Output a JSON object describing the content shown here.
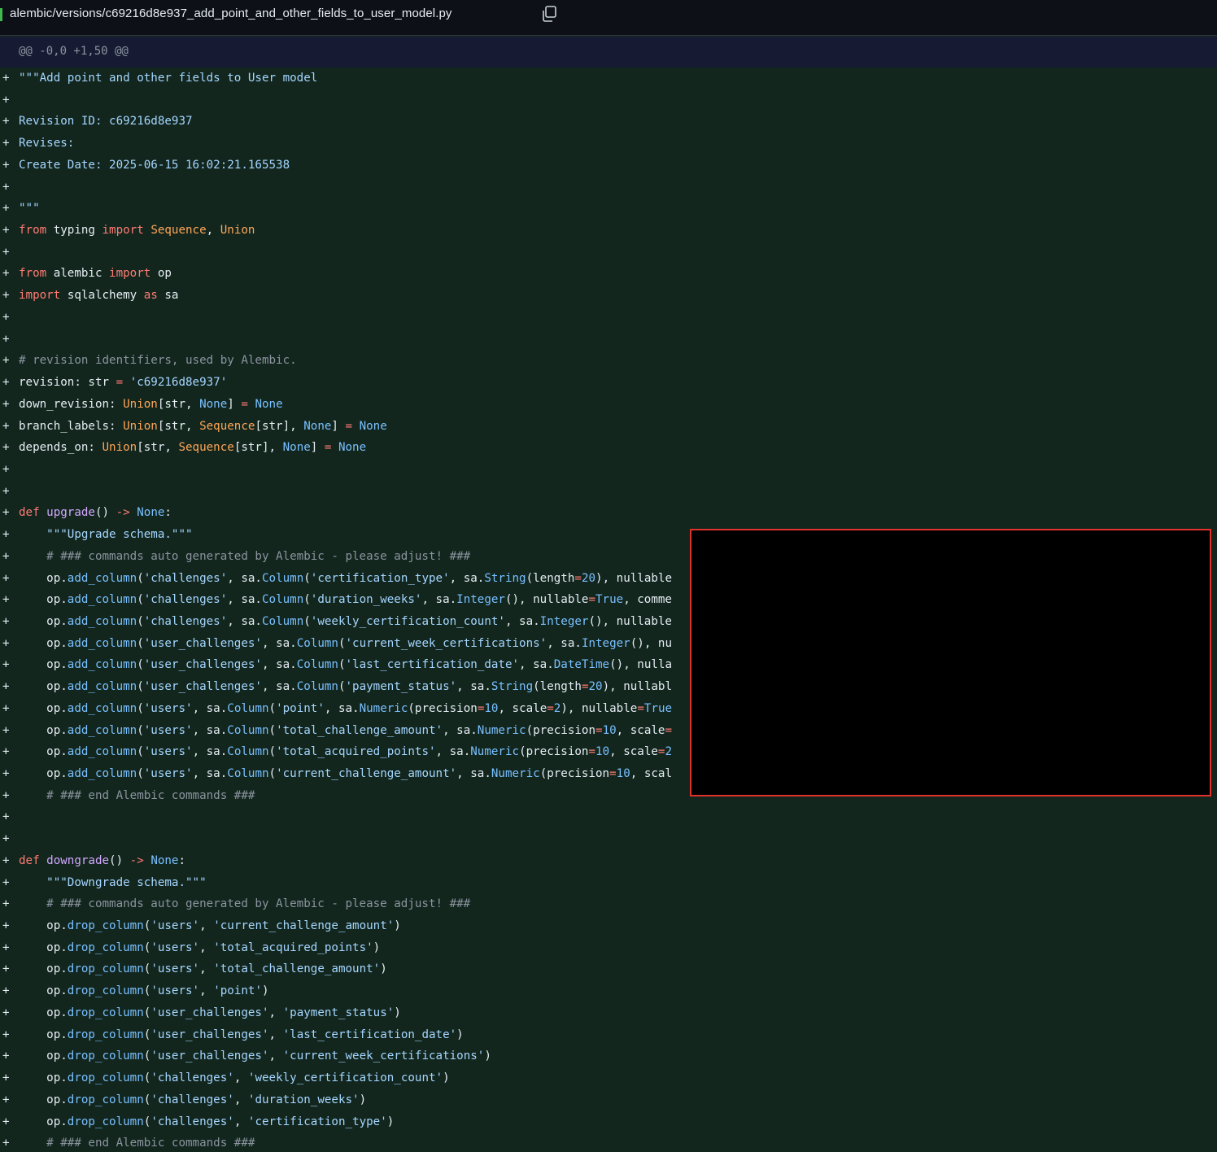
{
  "file": {
    "path": "alembic/versions/c69216d8e937_add_point_and_other_fields_to_user_model.py",
    "copy_icon": "copy-icon"
  },
  "hunk": {
    "header": "@@ -0,0 +1,50 @@"
  },
  "diff_marker": "+",
  "colors": {
    "added_bg": "#12261e",
    "keyword": "#ff7b72",
    "string": "#a5d6ff",
    "comment": "#8b949e",
    "function": "#d2a8ff",
    "class": "#ffa657",
    "constant": "#79c0ff"
  },
  "lines": [
    [
      [
        "s",
        "\"\"\"Add point and other fields to User model"
      ]
    ],
    [],
    [
      [
        "s",
        "Revision ID: c69216d8e937"
      ]
    ],
    [
      [
        "s",
        "Revises:"
      ]
    ],
    [
      [
        "s",
        "Create Date: 2025-06-15 16:02:21.165538"
      ]
    ],
    [],
    [
      [
        "s",
        "\"\"\""
      ]
    ],
    [
      [
        "k",
        "from"
      ],
      [
        "p",
        " typing "
      ],
      [
        "k",
        "import"
      ],
      [
        "p",
        " "
      ],
      [
        "y",
        "Sequence"
      ],
      [
        "p",
        ", "
      ],
      [
        "y",
        "Union"
      ]
    ],
    [],
    [
      [
        "k",
        "from"
      ],
      [
        "p",
        " alembic "
      ],
      [
        "k",
        "import"
      ],
      [
        "p",
        " op"
      ]
    ],
    [
      [
        "k",
        "import"
      ],
      [
        "p",
        " sqlalchemy "
      ],
      [
        "k",
        "as"
      ],
      [
        "p",
        " sa"
      ]
    ],
    [],
    [],
    [
      [
        "c",
        "# revision identifiers, used by Alembic."
      ]
    ],
    [
      [
        "p",
        "revision: str "
      ],
      [
        "k",
        "="
      ],
      [
        "p",
        " "
      ],
      [
        "s",
        "'c69216d8e937'"
      ]
    ],
    [
      [
        "p",
        "down_revision: "
      ],
      [
        "y",
        "Union"
      ],
      [
        "p",
        "[str, "
      ],
      [
        "n",
        "None"
      ],
      [
        "p",
        "] "
      ],
      [
        "k",
        "="
      ],
      [
        "p",
        " "
      ],
      [
        "n",
        "None"
      ]
    ],
    [
      [
        "p",
        "branch_labels: "
      ],
      [
        "y",
        "Union"
      ],
      [
        "p",
        "[str, "
      ],
      [
        "y",
        "Sequence"
      ],
      [
        "p",
        "[str], "
      ],
      [
        "n",
        "None"
      ],
      [
        "p",
        "] "
      ],
      [
        "k",
        "="
      ],
      [
        "p",
        " "
      ],
      [
        "n",
        "None"
      ]
    ],
    [
      [
        "p",
        "depends_on: "
      ],
      [
        "y",
        "Union"
      ],
      [
        "p",
        "[str, "
      ],
      [
        "y",
        "Sequence"
      ],
      [
        "p",
        "[str], "
      ],
      [
        "n",
        "None"
      ],
      [
        "p",
        "] "
      ],
      [
        "k",
        "="
      ],
      [
        "p",
        " "
      ],
      [
        "n",
        "None"
      ]
    ],
    [],
    [],
    [
      [
        "k",
        "def"
      ],
      [
        "p",
        " "
      ],
      [
        "f",
        "upgrade"
      ],
      [
        "p",
        "() "
      ],
      [
        "k",
        "->"
      ],
      [
        "p",
        " "
      ],
      [
        "n",
        "None"
      ],
      [
        "p",
        ":"
      ]
    ],
    [
      [
        "p",
        "    "
      ],
      [
        "s",
        "\"\"\"Upgrade schema.\"\"\""
      ]
    ],
    [
      [
        "p",
        "    "
      ],
      [
        "c",
        "# ### commands auto generated by Alembic - please adjust! ###"
      ]
    ],
    [
      [
        "p",
        "    op."
      ],
      [
        "n",
        "add_column"
      ],
      [
        "p",
        "("
      ],
      [
        "s",
        "'challenges'"
      ],
      [
        "p",
        ", sa."
      ],
      [
        "n",
        "Column"
      ],
      [
        "p",
        "("
      ],
      [
        "s",
        "'certification_type'"
      ],
      [
        "p",
        ", sa."
      ],
      [
        "n",
        "String"
      ],
      [
        "p",
        "(length"
      ],
      [
        "k",
        "="
      ],
      [
        "n",
        "20"
      ],
      [
        "p",
        "), nullable"
      ]
    ],
    [
      [
        "p",
        "    op."
      ],
      [
        "n",
        "add_column"
      ],
      [
        "p",
        "("
      ],
      [
        "s",
        "'challenges'"
      ],
      [
        "p",
        ", sa."
      ],
      [
        "n",
        "Column"
      ],
      [
        "p",
        "("
      ],
      [
        "s",
        "'duration_weeks'"
      ],
      [
        "p",
        ", sa."
      ],
      [
        "n",
        "Integer"
      ],
      [
        "p",
        "(), nullable"
      ],
      [
        "k",
        "="
      ],
      [
        "n",
        "True"
      ],
      [
        "p",
        ", comme"
      ]
    ],
    [
      [
        "p",
        "    op."
      ],
      [
        "n",
        "add_column"
      ],
      [
        "p",
        "("
      ],
      [
        "s",
        "'challenges'"
      ],
      [
        "p",
        ", sa."
      ],
      [
        "n",
        "Column"
      ],
      [
        "p",
        "("
      ],
      [
        "s",
        "'weekly_certification_count'"
      ],
      [
        "p",
        ", sa."
      ],
      [
        "n",
        "Integer"
      ],
      [
        "p",
        "(), nullable"
      ]
    ],
    [
      [
        "p",
        "    op."
      ],
      [
        "n",
        "add_column"
      ],
      [
        "p",
        "("
      ],
      [
        "s",
        "'user_challenges'"
      ],
      [
        "p",
        ", sa."
      ],
      [
        "n",
        "Column"
      ],
      [
        "p",
        "("
      ],
      [
        "s",
        "'current_week_certifications'"
      ],
      [
        "p",
        ", sa."
      ],
      [
        "n",
        "Integer"
      ],
      [
        "p",
        "(), nu"
      ]
    ],
    [
      [
        "p",
        "    op."
      ],
      [
        "n",
        "add_column"
      ],
      [
        "p",
        "("
      ],
      [
        "s",
        "'user_challenges'"
      ],
      [
        "p",
        ", sa."
      ],
      [
        "n",
        "Column"
      ],
      [
        "p",
        "("
      ],
      [
        "s",
        "'last_certification_date'"
      ],
      [
        "p",
        ", sa."
      ],
      [
        "n",
        "DateTime"
      ],
      [
        "p",
        "(), nulla"
      ]
    ],
    [
      [
        "p",
        "    op."
      ],
      [
        "n",
        "add_column"
      ],
      [
        "p",
        "("
      ],
      [
        "s",
        "'user_challenges'"
      ],
      [
        "p",
        ", sa."
      ],
      [
        "n",
        "Column"
      ],
      [
        "p",
        "("
      ],
      [
        "s",
        "'payment_status'"
      ],
      [
        "p",
        ", sa."
      ],
      [
        "n",
        "String"
      ],
      [
        "p",
        "(length"
      ],
      [
        "k",
        "="
      ],
      [
        "n",
        "20"
      ],
      [
        "p",
        "), nullabl"
      ]
    ],
    [
      [
        "p",
        "    op."
      ],
      [
        "n",
        "add_column"
      ],
      [
        "p",
        "("
      ],
      [
        "s",
        "'users'"
      ],
      [
        "p",
        ", sa."
      ],
      [
        "n",
        "Column"
      ],
      [
        "p",
        "("
      ],
      [
        "s",
        "'point'"
      ],
      [
        "p",
        ", sa."
      ],
      [
        "n",
        "Numeric"
      ],
      [
        "p",
        "(precision"
      ],
      [
        "k",
        "="
      ],
      [
        "n",
        "10"
      ],
      [
        "p",
        ", scale"
      ],
      [
        "k",
        "="
      ],
      [
        "n",
        "2"
      ],
      [
        "p",
        "), nullable"
      ],
      [
        "k",
        "="
      ],
      [
        "n",
        "True"
      ]
    ],
    [
      [
        "p",
        "    op."
      ],
      [
        "n",
        "add_column"
      ],
      [
        "p",
        "("
      ],
      [
        "s",
        "'users'"
      ],
      [
        "p",
        ", sa."
      ],
      [
        "n",
        "Column"
      ],
      [
        "p",
        "("
      ],
      [
        "s",
        "'total_challenge_amount'"
      ],
      [
        "p",
        ", sa."
      ],
      [
        "n",
        "Numeric"
      ],
      [
        "p",
        "(precision"
      ],
      [
        "k",
        "="
      ],
      [
        "n",
        "10"
      ],
      [
        "p",
        ", scale"
      ],
      [
        "k",
        "="
      ]
    ],
    [
      [
        "p",
        "    op."
      ],
      [
        "n",
        "add_column"
      ],
      [
        "p",
        "("
      ],
      [
        "s",
        "'users'"
      ],
      [
        "p",
        ", sa."
      ],
      [
        "n",
        "Column"
      ],
      [
        "p",
        "("
      ],
      [
        "s",
        "'total_acquired_points'"
      ],
      [
        "p",
        ", sa."
      ],
      [
        "n",
        "Numeric"
      ],
      [
        "p",
        "(precision"
      ],
      [
        "k",
        "="
      ],
      [
        "n",
        "10"
      ],
      [
        "p",
        ", scale"
      ],
      [
        "k",
        "="
      ],
      [
        "n",
        "2"
      ]
    ],
    [
      [
        "p",
        "    op."
      ],
      [
        "n",
        "add_column"
      ],
      [
        "p",
        "("
      ],
      [
        "s",
        "'users'"
      ],
      [
        "p",
        ", sa."
      ],
      [
        "n",
        "Column"
      ],
      [
        "p",
        "("
      ],
      [
        "s",
        "'current_challenge_amount'"
      ],
      [
        "p",
        ", sa."
      ],
      [
        "n",
        "Numeric"
      ],
      [
        "p",
        "(precision"
      ],
      [
        "k",
        "="
      ],
      [
        "n",
        "10"
      ],
      [
        "p",
        ", scal"
      ]
    ],
    [
      [
        "p",
        "    "
      ],
      [
        "c",
        "# ### end Alembic commands ###"
      ]
    ],
    [],
    [],
    [
      [
        "k",
        "def"
      ],
      [
        "p",
        " "
      ],
      [
        "f",
        "downgrade"
      ],
      [
        "p",
        "() "
      ],
      [
        "k",
        "->"
      ],
      [
        "p",
        " "
      ],
      [
        "n",
        "None"
      ],
      [
        "p",
        ":"
      ]
    ],
    [
      [
        "p",
        "    "
      ],
      [
        "s",
        "\"\"\"Downgrade schema.\"\"\""
      ]
    ],
    [
      [
        "p",
        "    "
      ],
      [
        "c",
        "# ### commands auto generated by Alembic - please adjust! ###"
      ]
    ],
    [
      [
        "p",
        "    op."
      ],
      [
        "n",
        "drop_column"
      ],
      [
        "p",
        "("
      ],
      [
        "s",
        "'users'"
      ],
      [
        "p",
        ", "
      ],
      [
        "s",
        "'current_challenge_amount'"
      ],
      [
        "p",
        ")"
      ]
    ],
    [
      [
        "p",
        "    op."
      ],
      [
        "n",
        "drop_column"
      ],
      [
        "p",
        "("
      ],
      [
        "s",
        "'users'"
      ],
      [
        "p",
        ", "
      ],
      [
        "s",
        "'total_acquired_points'"
      ],
      [
        "p",
        ")"
      ]
    ],
    [
      [
        "p",
        "    op."
      ],
      [
        "n",
        "drop_column"
      ],
      [
        "p",
        "("
      ],
      [
        "s",
        "'users'"
      ],
      [
        "p",
        ", "
      ],
      [
        "s",
        "'total_challenge_amount'"
      ],
      [
        "p",
        ")"
      ]
    ],
    [
      [
        "p",
        "    op."
      ],
      [
        "n",
        "drop_column"
      ],
      [
        "p",
        "("
      ],
      [
        "s",
        "'users'"
      ],
      [
        "p",
        ", "
      ],
      [
        "s",
        "'point'"
      ],
      [
        "p",
        ")"
      ]
    ],
    [
      [
        "p",
        "    op."
      ],
      [
        "n",
        "drop_column"
      ],
      [
        "p",
        "("
      ],
      [
        "s",
        "'user_challenges'"
      ],
      [
        "p",
        ", "
      ],
      [
        "s",
        "'payment_status'"
      ],
      [
        "p",
        ")"
      ]
    ],
    [
      [
        "p",
        "    op."
      ],
      [
        "n",
        "drop_column"
      ],
      [
        "p",
        "("
      ],
      [
        "s",
        "'user_challenges'"
      ],
      [
        "p",
        ", "
      ],
      [
        "s",
        "'last_certification_date'"
      ],
      [
        "p",
        ")"
      ]
    ],
    [
      [
        "p",
        "    op."
      ],
      [
        "n",
        "drop_column"
      ],
      [
        "p",
        "("
      ],
      [
        "s",
        "'user_challenges'"
      ],
      [
        "p",
        ", "
      ],
      [
        "s",
        "'current_week_certifications'"
      ],
      [
        "p",
        ")"
      ]
    ],
    [
      [
        "p",
        "    op."
      ],
      [
        "n",
        "drop_column"
      ],
      [
        "p",
        "("
      ],
      [
        "s",
        "'challenges'"
      ],
      [
        "p",
        ", "
      ],
      [
        "s",
        "'weekly_certification_count'"
      ],
      [
        "p",
        ")"
      ]
    ],
    [
      [
        "p",
        "    op."
      ],
      [
        "n",
        "drop_column"
      ],
      [
        "p",
        "("
      ],
      [
        "s",
        "'challenges'"
      ],
      [
        "p",
        ", "
      ],
      [
        "s",
        "'duration_weeks'"
      ],
      [
        "p",
        ")"
      ]
    ],
    [
      [
        "p",
        "    op."
      ],
      [
        "n",
        "drop_column"
      ],
      [
        "p",
        "("
      ],
      [
        "s",
        "'challenges'"
      ],
      [
        "p",
        ", "
      ],
      [
        "s",
        "'certification_type'"
      ],
      [
        "p",
        ")"
      ]
    ],
    [
      [
        "p",
        "    "
      ],
      [
        "c",
        "# ### end Alembic commands ###"
      ]
    ]
  ]
}
